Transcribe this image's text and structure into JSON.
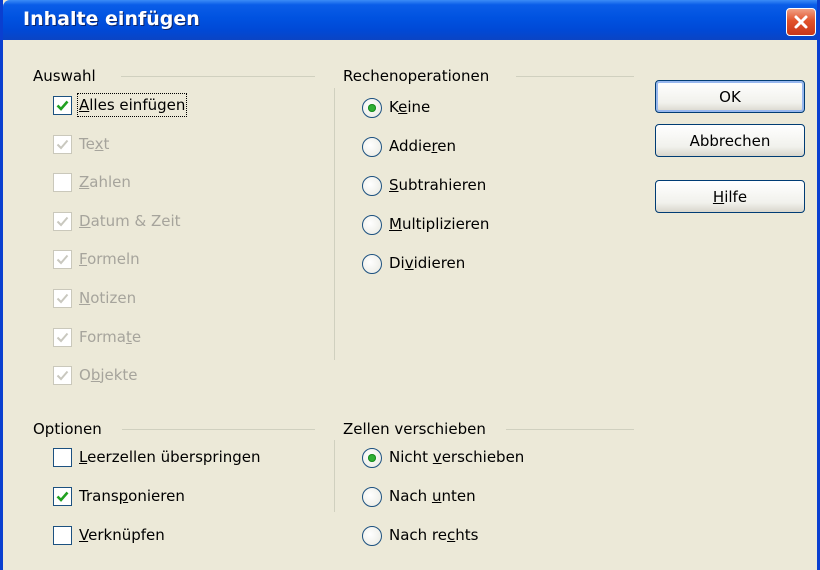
{
  "window": {
    "title": "Inhalte einfügen",
    "close_label": "Schließen"
  },
  "selection": {
    "heading": "Auswahl",
    "items": [
      {
        "pre": "",
        "key": "A",
        "post": "lles einfügen",
        "checked": true,
        "enabled": true
      },
      {
        "pre": "Te",
        "key": "x",
        "post": "t",
        "checked": true,
        "enabled": false
      },
      {
        "pre": "",
        "key": "Z",
        "post": "ahlen",
        "checked": false,
        "enabled": false
      },
      {
        "pre": "",
        "key": "D",
        "post": "atum & Zeit",
        "checked": true,
        "enabled": false
      },
      {
        "pre": "",
        "key": "F",
        "post": "ormeln",
        "checked": true,
        "enabled": false
      },
      {
        "pre": "",
        "key": "N",
        "post": "otizen",
        "checked": true,
        "enabled": false
      },
      {
        "pre": "Forma",
        "key": "t",
        "post": "e",
        "checked": true,
        "enabled": false
      },
      {
        "pre": "O",
        "key": "b",
        "post": "jekte",
        "checked": true,
        "enabled": false
      }
    ]
  },
  "operations": {
    "heading": "Rechenoperationen",
    "items": [
      {
        "pre": "K",
        "key": "e",
        "post": "ine",
        "selected": true
      },
      {
        "pre": "Addie",
        "key": "r",
        "post": "en",
        "selected": false
      },
      {
        "pre": "",
        "key": "S",
        "post": "ubtrahieren",
        "selected": false
      },
      {
        "pre": "",
        "key": "M",
        "post": "ultiplizieren",
        "selected": false
      },
      {
        "pre": "Di",
        "key": "v",
        "post": "idieren",
        "selected": false
      }
    ]
  },
  "options": {
    "heading": "Optionen",
    "items": [
      {
        "pre": "",
        "key": "L",
        "post": "eerzellen überspringen",
        "checked": false
      },
      {
        "pre": "Trans",
        "key": "p",
        "post": "onieren",
        "checked": true
      },
      {
        "pre": "",
        "key": "V",
        "post": "erknüpfen",
        "checked": false
      }
    ]
  },
  "shift": {
    "heading": "Zellen verschieben",
    "items": [
      {
        "pre": "Nicht ",
        "key": "v",
        "post": "erschieben",
        "selected": true
      },
      {
        "pre": "Nach ",
        "key": "u",
        "post": "nten",
        "selected": false
      },
      {
        "pre": "Nach re",
        "key": "c",
        "post": "hts",
        "selected": false
      }
    ]
  },
  "buttons": {
    "ok": "OK",
    "cancel": "Abbrechen",
    "help_key": "H",
    "help_rest": "ilfe"
  },
  "colors": {
    "title_bar": "#0052e0",
    "dialog_bg": "#ece9d8",
    "check_mark": "#21a121",
    "radio_dot": "#2fb033",
    "disabled_text": "#a6a49c"
  }
}
